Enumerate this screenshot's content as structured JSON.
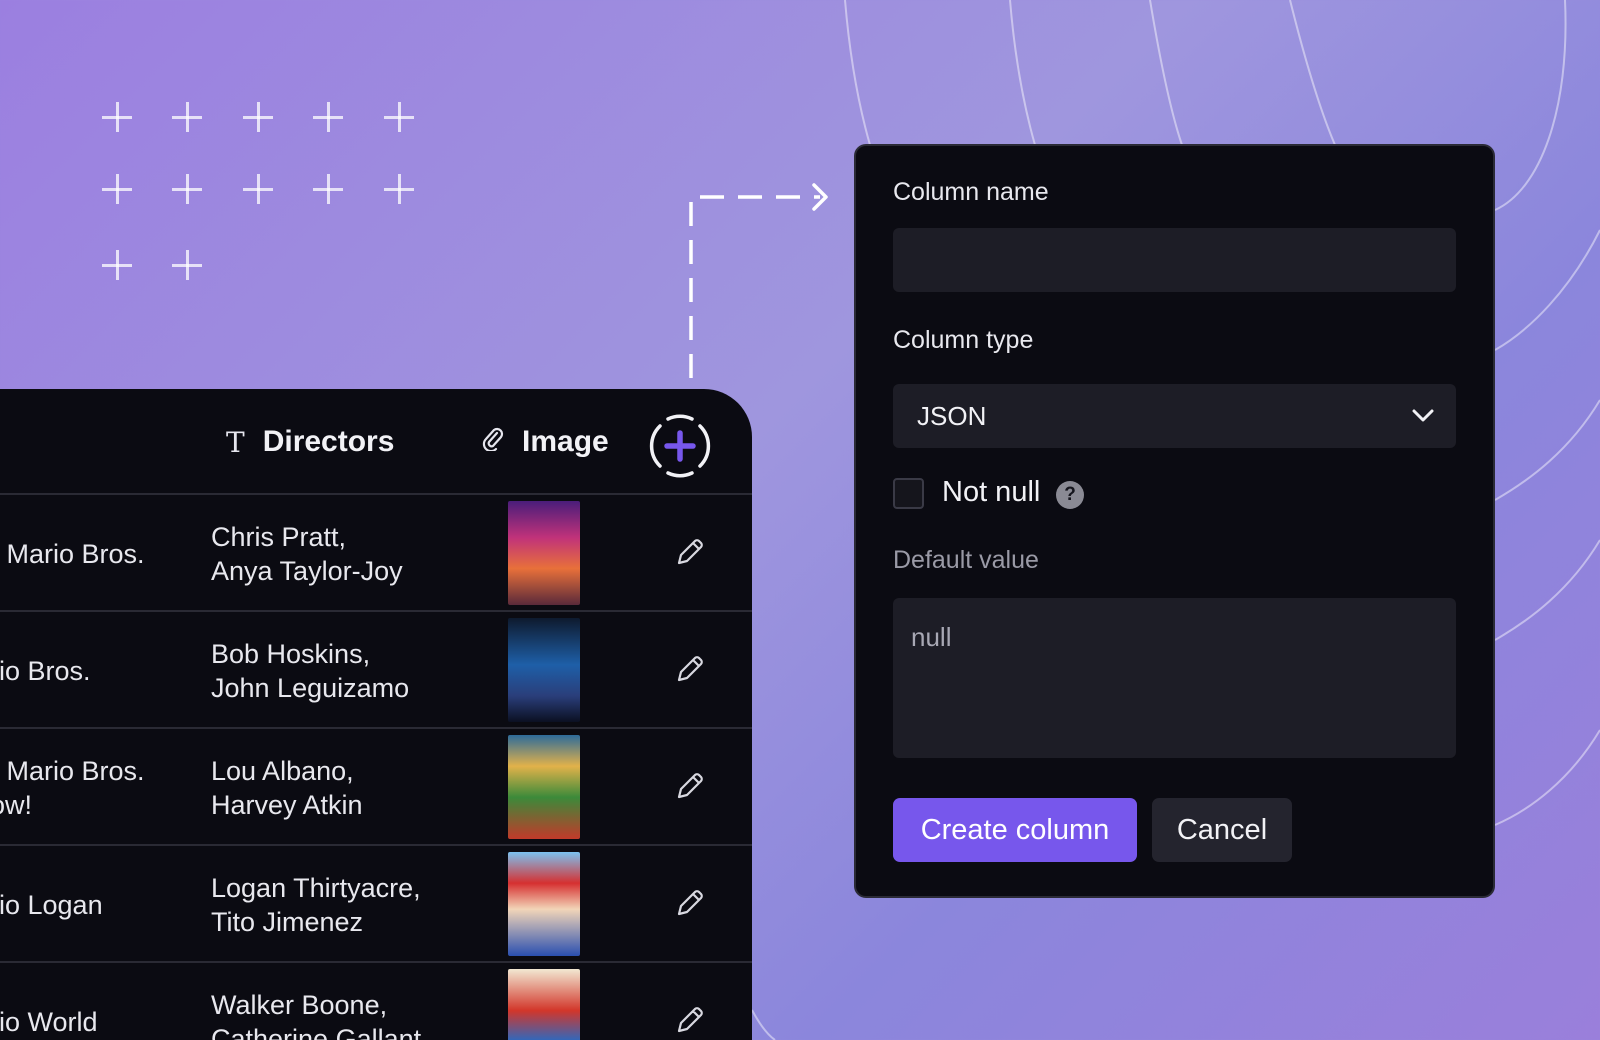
{
  "table": {
    "columns": [
      {
        "label": "Directors",
        "icon": "text-type-icon"
      },
      {
        "label": "Image",
        "icon": "attachment-icon"
      }
    ],
    "rows": [
      {
        "title": "r Mario Bros.",
        "directors": "Chris Pratt,\nAnya Taylor-Joy",
        "poster": "movie-poster-1"
      },
      {
        "title": "rio Bros.",
        "directors": "Bob Hoskins,\nJohn Leguizamo",
        "poster": "movie-poster-2"
      },
      {
        "title": "r Mario Bros.\now!",
        "directors": "Lou Albano,\nHarvey Atkin",
        "poster": "movie-poster-3"
      },
      {
        "title": "rio Logan",
        "directors": "Logan Thirtyacre,\nTito Jimenez",
        "poster": "movie-poster-4"
      },
      {
        "title": "rio World",
        "directors": "Walker Boone,\nCatherine Gallant",
        "poster": "movie-poster-5"
      }
    ],
    "add_column_icon": "add-column-icon",
    "edit_icon": "pencil-icon"
  },
  "dialog": {
    "column_name_label": "Column name",
    "column_name_value": "",
    "column_type_label": "Column type",
    "column_type_value": "JSON",
    "not_null_label": "Not null",
    "not_null_checked": false,
    "help_glyph": "?",
    "default_value_label": "Default value",
    "default_value_text": "null",
    "create_button": "Create column",
    "cancel_button": "Cancel"
  },
  "colors": {
    "accent": "#7757ec",
    "panel": "#0b0b12",
    "field": "#1d1d26"
  }
}
